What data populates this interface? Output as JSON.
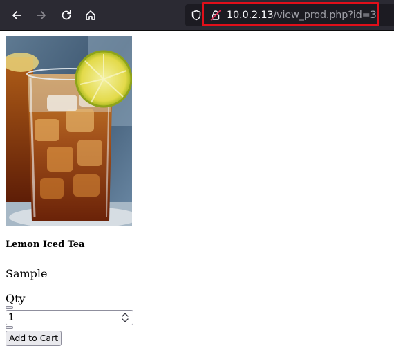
{
  "browser": {
    "url_host": "10.0.2.13",
    "url_path": "/view_prod.php?id=3",
    "colors": {
      "toolbar": "#2b2a33",
      "urlbar": "#1c1b22",
      "highlight": "#e10f1a"
    },
    "icons": [
      "back-arrow-icon",
      "forward-arrow-icon",
      "reload-icon",
      "home-icon",
      "shield-icon",
      "lock-icon"
    ]
  },
  "product": {
    "name": "Lemon Iced Tea",
    "description": "Sample",
    "image_icon": "iced-tea-photo"
  },
  "cart_form": {
    "qty_label": "Qty",
    "qty_value": "1",
    "add_button_label": "Add to Cart"
  }
}
